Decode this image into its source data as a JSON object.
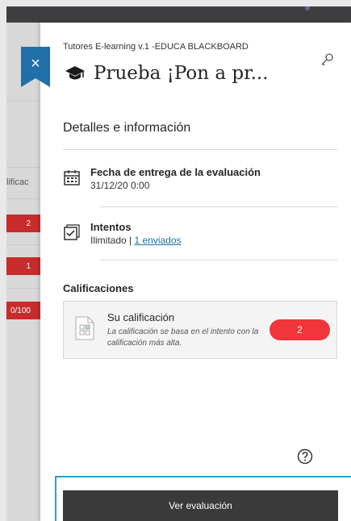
{
  "background": {
    "column_header": "lificac",
    "cells": [
      "2",
      "1",
      "0/100"
    ]
  },
  "close_icon": "×",
  "panel": {
    "breadcrumb": "Tutores E-learning v.1 -EDUCA BLACKBOARD",
    "title": "Prueba ¡Pon a pr...",
    "title_icon": "graduation-cap-icon",
    "section_title": "Detalles e información",
    "due": {
      "label": "Fecha de entrega de la evaluación",
      "value": "31/12/20 0:00"
    },
    "attempts": {
      "label": "Intentos",
      "value_prefix": "Ilimitado | ",
      "link": "1 enviados"
    },
    "grades_heading": "Calificaciones",
    "grade": {
      "label": "Su calificación",
      "description": "La calificación se basa en el intento con la calificación más alta.",
      "value": "2",
      "color": "#f0363a"
    },
    "view_button": "Ver evaluación"
  },
  "colors": {
    "accent": "#1f6fa8",
    "danger": "#c72b2b",
    "focus": "#2a9fd6"
  }
}
